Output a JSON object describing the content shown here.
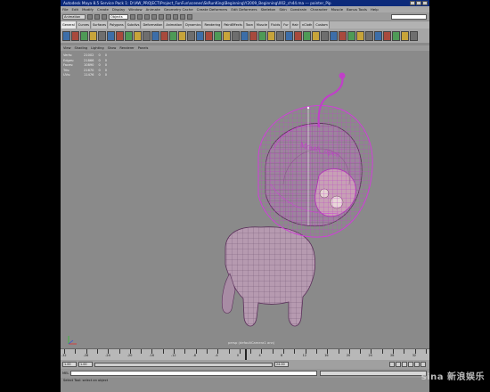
{
  "window": {
    "title": "Autodesk Maya 8.5 Service Pack 1: D:\\AW_PROJECT\\Project_FunFun\\scenes\\SkRunKing\\Beginning\\Y2009_Beginning\\002_ch44.ma   ---   pointer_Pip"
  },
  "menu": [
    "File",
    "Edit",
    "Modify",
    "Create",
    "Display",
    "Window",
    "Animate",
    "Geometry Cache",
    "Create Deformers",
    "Edit Deformers",
    "Skeleton",
    "Skin",
    "Constrain",
    "Character",
    "Muscle",
    "Bonus Tools",
    "Help"
  ],
  "status": {
    "mode": "Animation",
    "objects_field": "Objects"
  },
  "shelf_tabs": [
    "General",
    "Curves",
    "Surfaces",
    "Polygons",
    "Subdivs",
    "Deformation",
    "Animation",
    "Dynamics",
    "Rendering",
    "PaintEffects",
    "Toon",
    "Muscle",
    "Fluids",
    "Fur",
    "Hair",
    "nCloth",
    "Custom"
  ],
  "panel_menu": [
    "View",
    "Shading",
    "Lighting",
    "Show",
    "Renderer",
    "Panels"
  ],
  "hud": {
    "rows": [
      {
        "k": "Verts:",
        "a": "21002",
        "b": "0",
        "c": "0"
      },
      {
        "k": "Edges:",
        "a": "21866",
        "b": "0",
        "c": "0"
      },
      {
        "k": "Faces:",
        "a": "10890",
        "b": "0",
        "c": "0"
      },
      {
        "k": "Tris:",
        "a": "21670",
        "b": "0",
        "c": "0"
      },
      {
        "k": "UVs:",
        "a": "11476",
        "b": "0",
        "c": "0"
      }
    ]
  },
  "annotation": "Mouth_open",
  "camera_label": "persp (defaultCamera1 ann)",
  "timeline": {
    "start": -32,
    "end": 34,
    "current": "1.00",
    "range_start": "1.00",
    "range_end": "24.00"
  },
  "cmd": {
    "label": "MEL"
  },
  "help": "Select Tool: select an object",
  "watermark": "sina 新浪娱乐"
}
